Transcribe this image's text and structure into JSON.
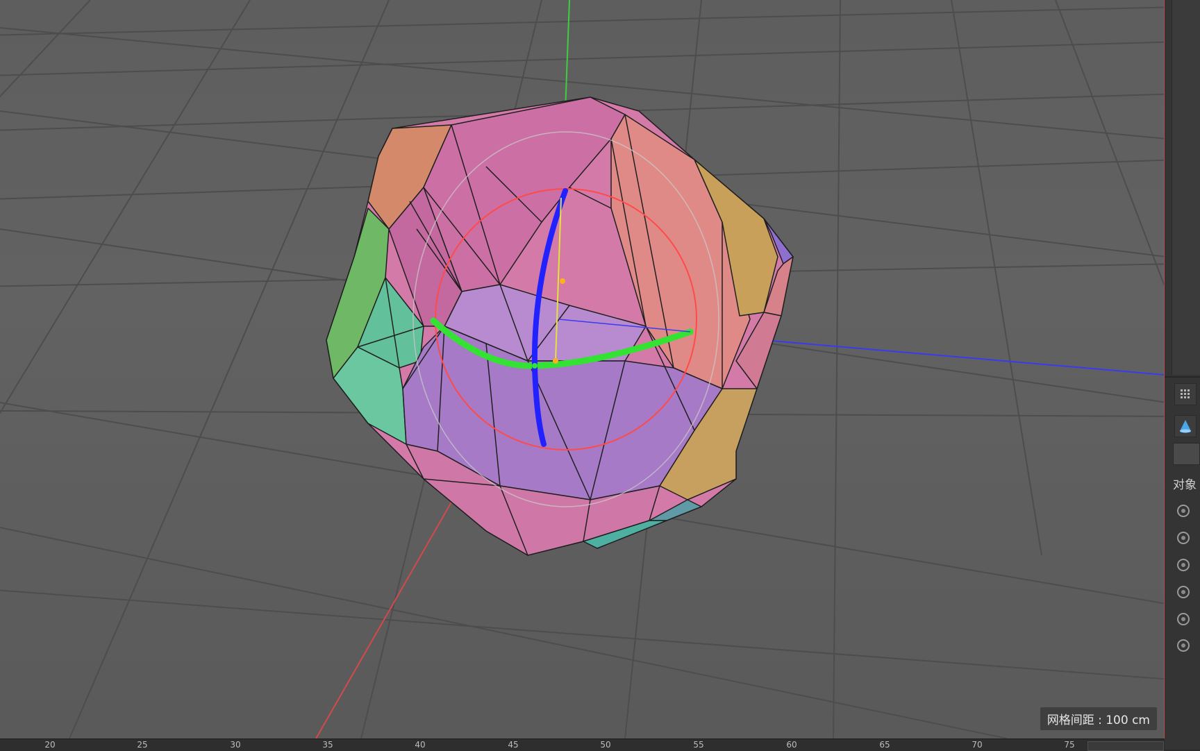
{
  "viewport": {
    "grid_spacing_label": "网格间距 : 100 cm"
  },
  "timeline": {
    "ticks": [
      "20",
      "25",
      "30",
      "35",
      "40",
      "45",
      "50",
      "55",
      "60",
      "65",
      "70",
      "75"
    ]
  },
  "side_panel": {
    "label": "对象",
    "icons": [
      "grid-icon",
      "cone-icon"
    ],
    "radio_count": 6
  },
  "colors": {
    "viewport_bg": "#5e5e5e",
    "grid_line": "#4a4a4a",
    "axis_x": "#d24a4a",
    "axis_y": "#3ecf3e",
    "axis_z": "#3a3aee",
    "gizmo_ring": "#ff4a4a",
    "gizmo_green": "#33e233",
    "gizmo_blue": "#2222ff"
  }
}
